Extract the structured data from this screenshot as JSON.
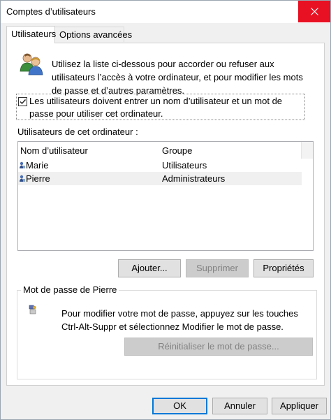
{
  "window": {
    "title": "Comptes d’utilisateurs"
  },
  "tabs": [
    {
      "label": "Utilisateurs",
      "active": true
    },
    {
      "label": "Options avancées",
      "active": false
    }
  ],
  "intro": "Utilisez la liste ci-dessous pour accorder ou refuser aux utilisateurs l’accès à votre ordinateur, et pour modifier les mots de passe et d’autres paramètres.",
  "require_password": {
    "label": "Les utilisateurs doivent entrer un nom d’utilisateur et un mot de passe pour utiliser cet ordinateur.",
    "checked": true
  },
  "users": {
    "label": "Utilisateurs de cet ordinateur :",
    "columns": [
      "Nom d’utilisateur",
      "Groupe"
    ],
    "rows": [
      {
        "name": "Marie",
        "group": "Utilisateurs",
        "selected": false
      },
      {
        "name": "Pierre",
        "group": "Administrateurs",
        "selected": true
      }
    ]
  },
  "actions": {
    "add": "Ajouter...",
    "remove": "Supprimer",
    "properties": "Propriétés"
  },
  "password_group": {
    "title": "Mot de passe de Pierre",
    "text": "Pour modifier votre mot de passe, appuyez sur les touches Ctrl-Alt-Suppr et sélectionnez Modifier le mot de passe.",
    "reset_button": "Réinitialiser le mot de passe..."
  },
  "footer": {
    "ok": "OK",
    "cancel": "Annuler",
    "apply": "Appliquer"
  },
  "colors": {
    "close_button": "#e81123",
    "default_button_border": "#0078d7",
    "selected_row": "#f0f0f0"
  },
  "icons": [
    "users-icon",
    "checkmark-icon",
    "user-icon",
    "key-icon",
    "close-icon"
  ]
}
